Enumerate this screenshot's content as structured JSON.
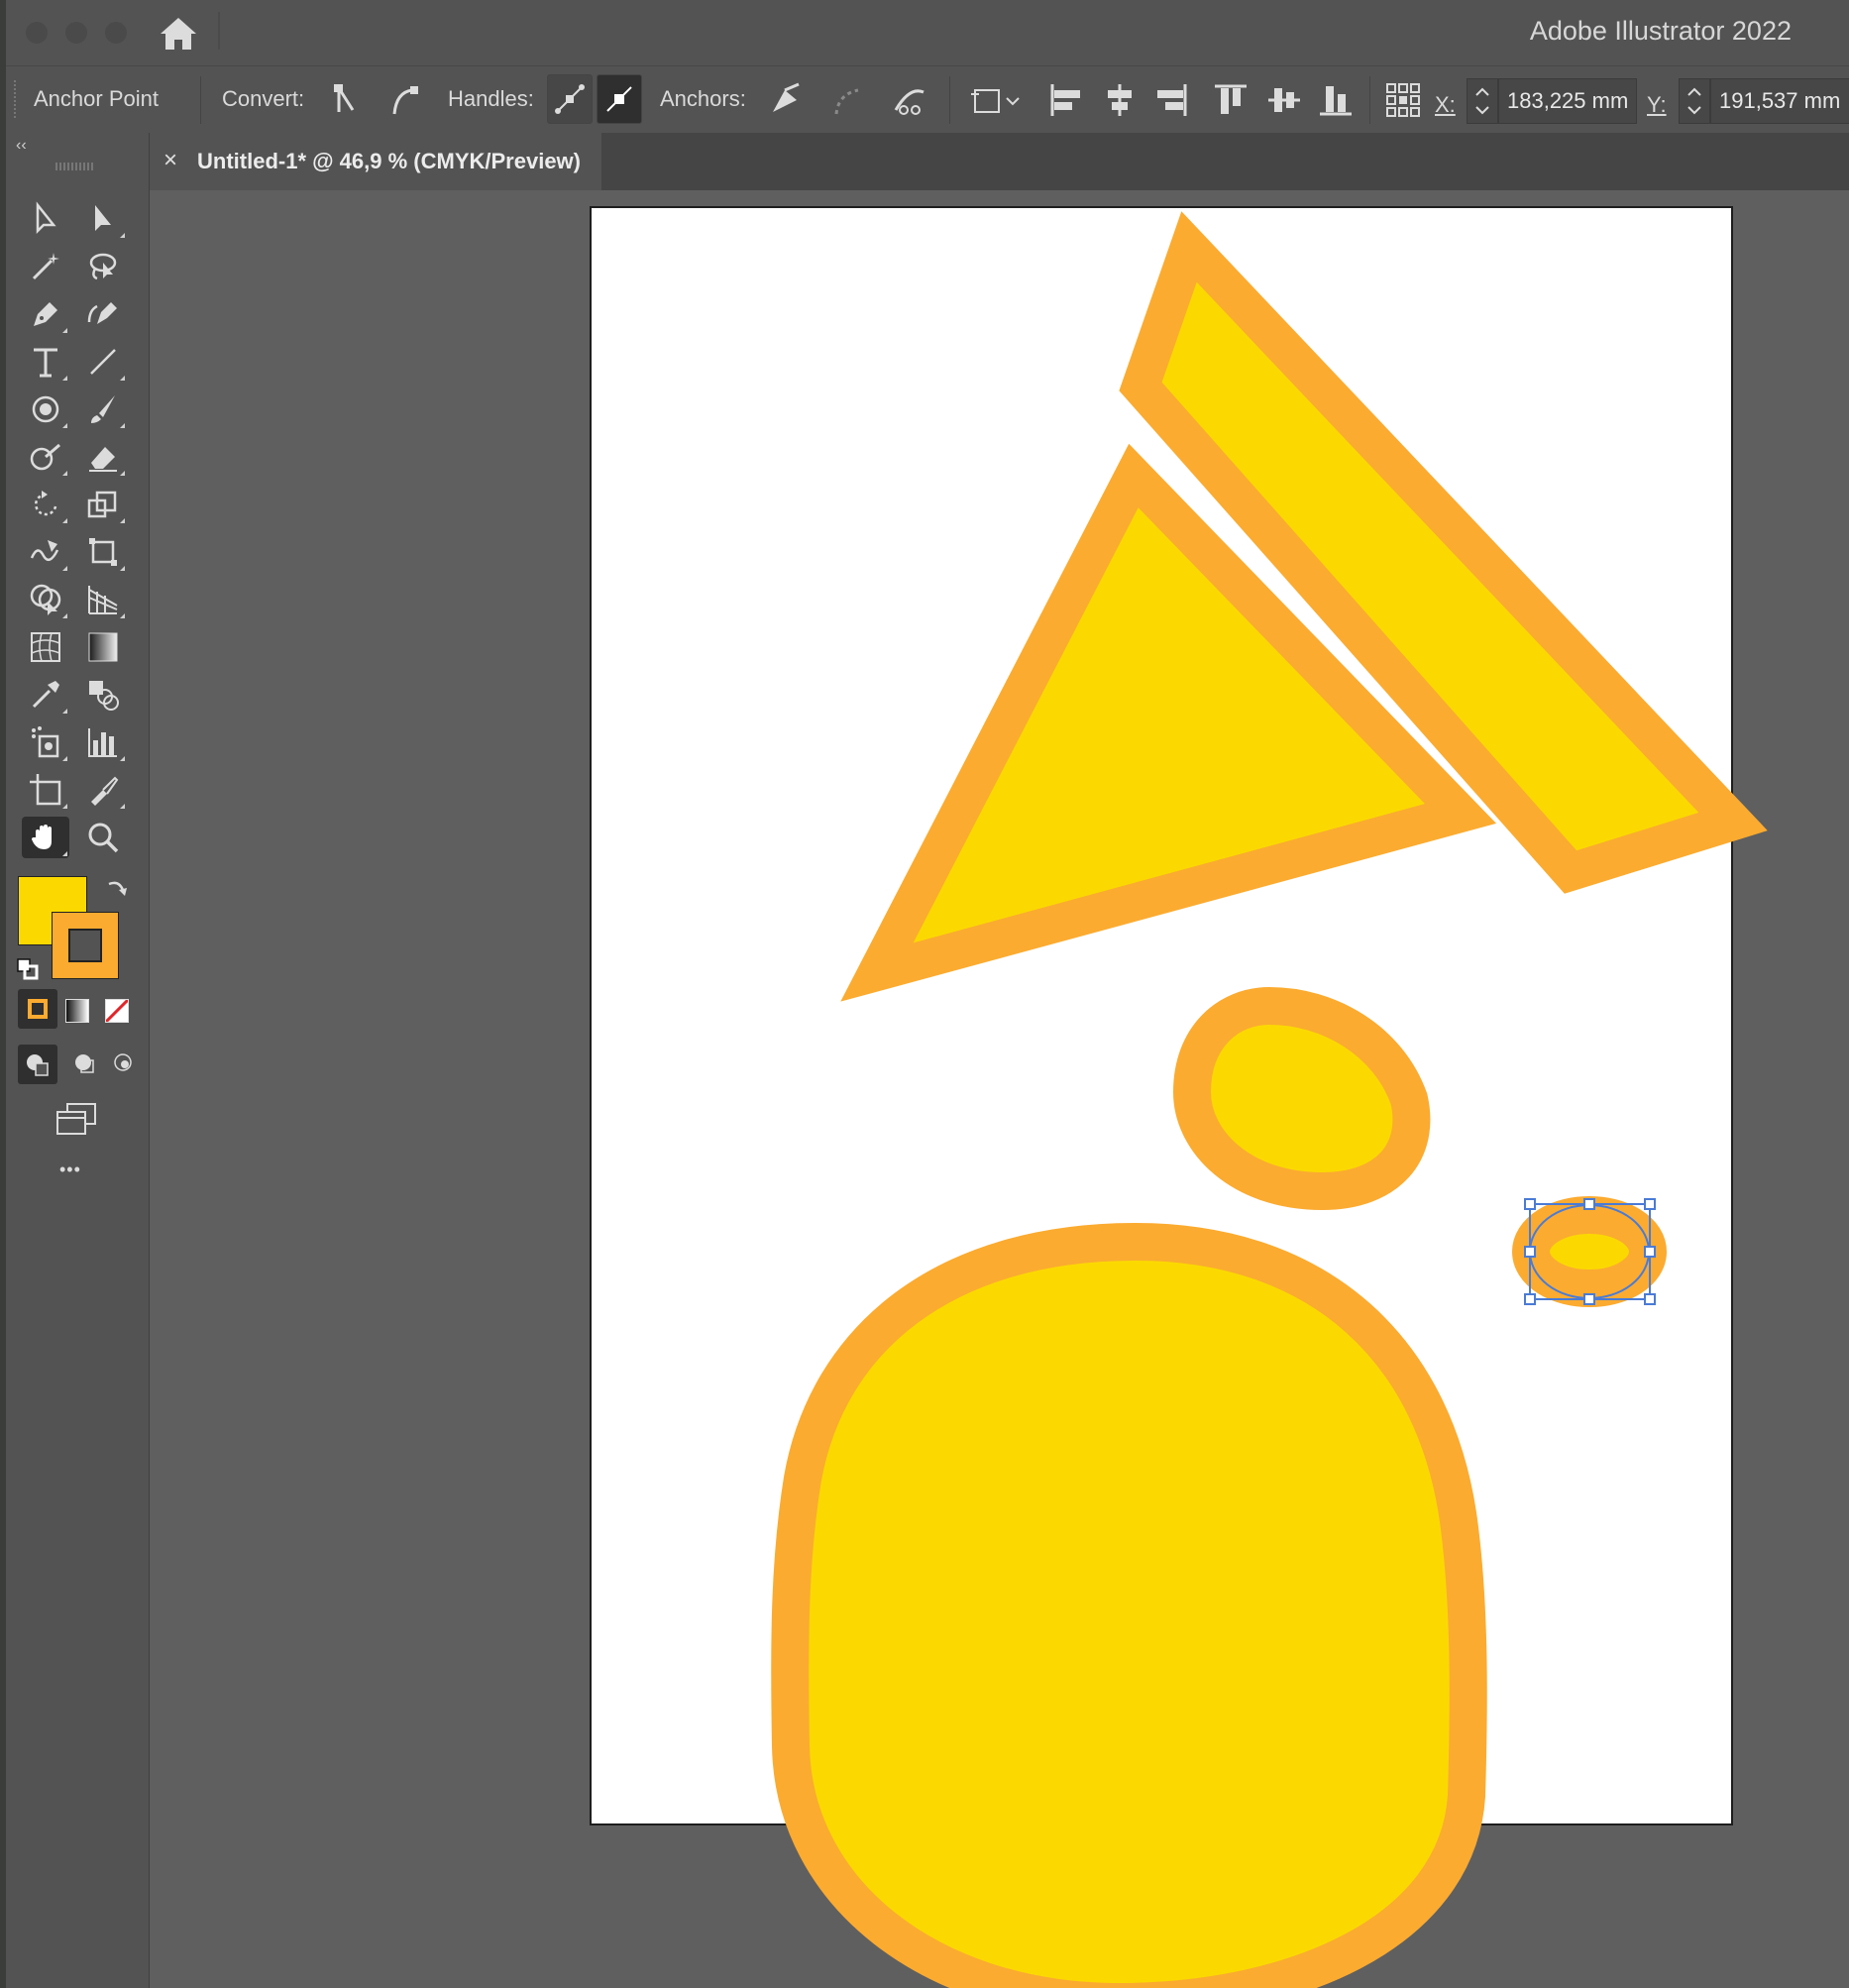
{
  "window": {
    "app_title": "Adobe Illustrator 2022"
  },
  "control_bar": {
    "tool_name": "Anchor Point",
    "convert_label": "Convert:",
    "handles_label": "Handles:",
    "anchors_label": "Anchors:",
    "x_label": "X:",
    "x_value": "183,225 mm",
    "y_label": "Y:",
    "y_value": "191,537 mm"
  },
  "document_tab": {
    "title": "Untitled-1* @ 46,9 % (CMYK/Preview)",
    "close_glyph": "×"
  },
  "toolbar": {
    "collapse_glyph": "‹‹",
    "more_glyph": "•••",
    "active_tool": "hand-tool",
    "fill_color": "#fbd900",
    "stroke_color": "#fbab30"
  },
  "colors": {
    "shape_fill": "#fbd900",
    "shape_stroke": "#fbab30",
    "selection": "#4a7bd6"
  },
  "artwork": {
    "shapes": [
      "large-triangle",
      "slanted-quad",
      "small-blob",
      "large-blob",
      "selected-ellipse"
    ]
  }
}
